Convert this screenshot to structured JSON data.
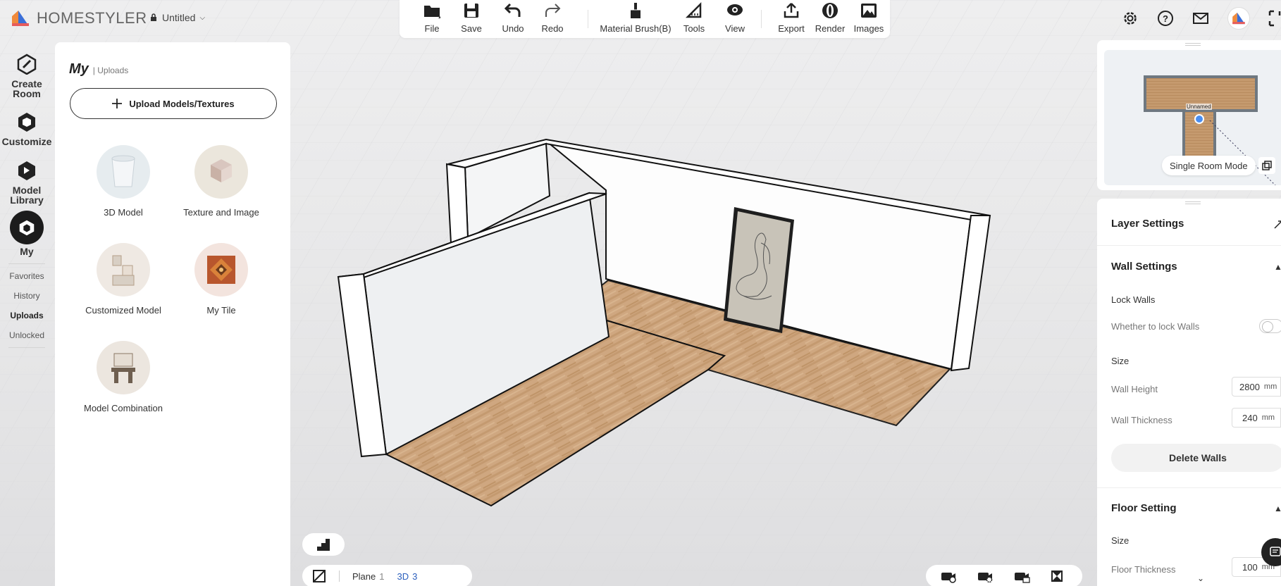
{
  "app": {
    "brand": "HOMESTYLER",
    "doc_title": "Untitled"
  },
  "toolbar": {
    "items": [
      {
        "label": "File"
      },
      {
        "label": "Save"
      },
      {
        "label": "Undo"
      },
      {
        "label": "Redo"
      },
      {
        "label": "Material Brush(B)"
      },
      {
        "label": "Tools"
      },
      {
        "label": "View"
      },
      {
        "label": "Export"
      },
      {
        "label": "Render"
      },
      {
        "label": "Images"
      }
    ]
  },
  "rail": {
    "create_room": "Create Room",
    "customize": "Customize",
    "model_library": "Model Library",
    "my": "My",
    "sub": [
      "Favorites",
      "History",
      "Uploads",
      "Unlocked"
    ],
    "active_sub": "Uploads"
  },
  "panel": {
    "title": "My",
    "crumb": "| Uploads",
    "upload_label": "Upload Models/Textures",
    "categories": [
      {
        "label": "3D Model"
      },
      {
        "label": "Texture and Image"
      },
      {
        "label": "Customized Model"
      },
      {
        "label": "My Tile"
      },
      {
        "label": "Model Combination"
      }
    ]
  },
  "minimap": {
    "room_label": "Unnamed",
    "mode_button": "Single Room Mode"
  },
  "props": {
    "layer_settings": "Layer Settings",
    "wall_settings": "Wall Settings",
    "lock_walls": "Lock Walls",
    "lock_walls_desc": "Whether to lock Walls",
    "lock_walls_on": false,
    "size": "Size",
    "wall_height_label": "Wall Height",
    "wall_height": "2800",
    "wall_thickness_label": "Wall Thickness",
    "wall_thickness": "240",
    "unit": "mm",
    "delete_walls": "Delete Walls",
    "floor_setting": "Floor Setting",
    "floor_size": "Size",
    "floor_thickness_label": "Floor Thickness",
    "floor_thickness": "100"
  },
  "bottom": {
    "plane_label": "Plane",
    "plane_num": "1",
    "view3d_label": "3D",
    "view3d_num": "3",
    "active_view": "3D"
  },
  "colors": {
    "accent": "#2b5fbd",
    "floor": "#c9a27a",
    "panel": "#ffffff"
  }
}
